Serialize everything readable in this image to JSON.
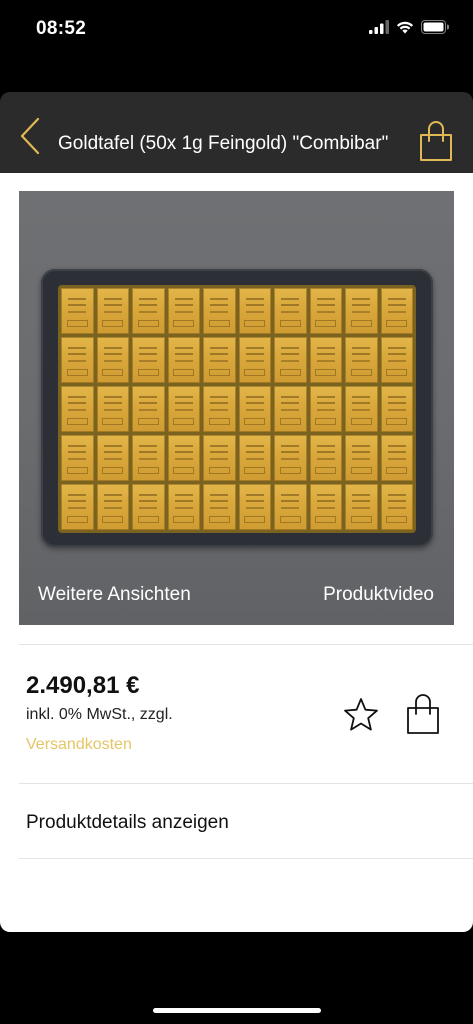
{
  "status_bar": {
    "time": "08:52"
  },
  "nav": {
    "title": "Goldtafel (50x 1g Feingold) \"Combibar\"",
    "accent_color": "#e0b954"
  },
  "product": {
    "image_grid": {
      "rows": 5,
      "columns": 10
    },
    "more_views_label": "Weitere Ansichten",
    "video_label": "Produktvideo",
    "price": "2.490,81 €",
    "tax_note": "inkl. 0% MwSt., zzgl.",
    "shipping_link": "Versandkosten",
    "shipping_color": "#e5c566"
  },
  "actions": {
    "favorite_icon": "star-icon",
    "cart_icon": "shopping-bag-icon"
  },
  "details": {
    "label": "Produktdetails anzeigen"
  }
}
